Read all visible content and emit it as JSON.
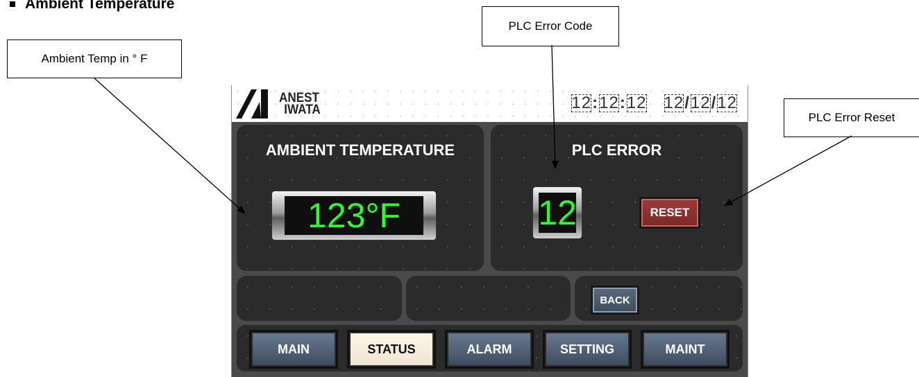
{
  "heading": "Ambient Temperature",
  "callouts": {
    "ambient": "Ambient Temp in ° F",
    "plc_code": "PLC Error Code",
    "plc_reset": "PLC Error Reset"
  },
  "hmi": {
    "logo_line1": "ANEST",
    "logo_line2": "IWATA",
    "time_h": "12",
    "time_sep1": ":",
    "time_m": "12",
    "time_sep2": ":",
    "time_s": "12",
    "date_1": "12",
    "date_sep1": "/",
    "date_2": "12",
    "date_sep2": "/",
    "date_3": "12",
    "ambient_title": "AMBIENT TEMPERATURE",
    "ambient_value": "123°F",
    "plc_title": "PLC ERROR",
    "plc_value": "12",
    "reset_label": "RESET",
    "back_label": "BACK",
    "nav": {
      "main": "MAIN",
      "status": "STATUS",
      "alarm": "ALARM",
      "setting": "SETTING",
      "maint": "MAINT"
    },
    "active_nav": "STATUS"
  },
  "colors": {
    "led": "#28ff28",
    "reset": "#8a3230",
    "nav": "#4a5a70",
    "active_nav": "#f7ede0"
  }
}
